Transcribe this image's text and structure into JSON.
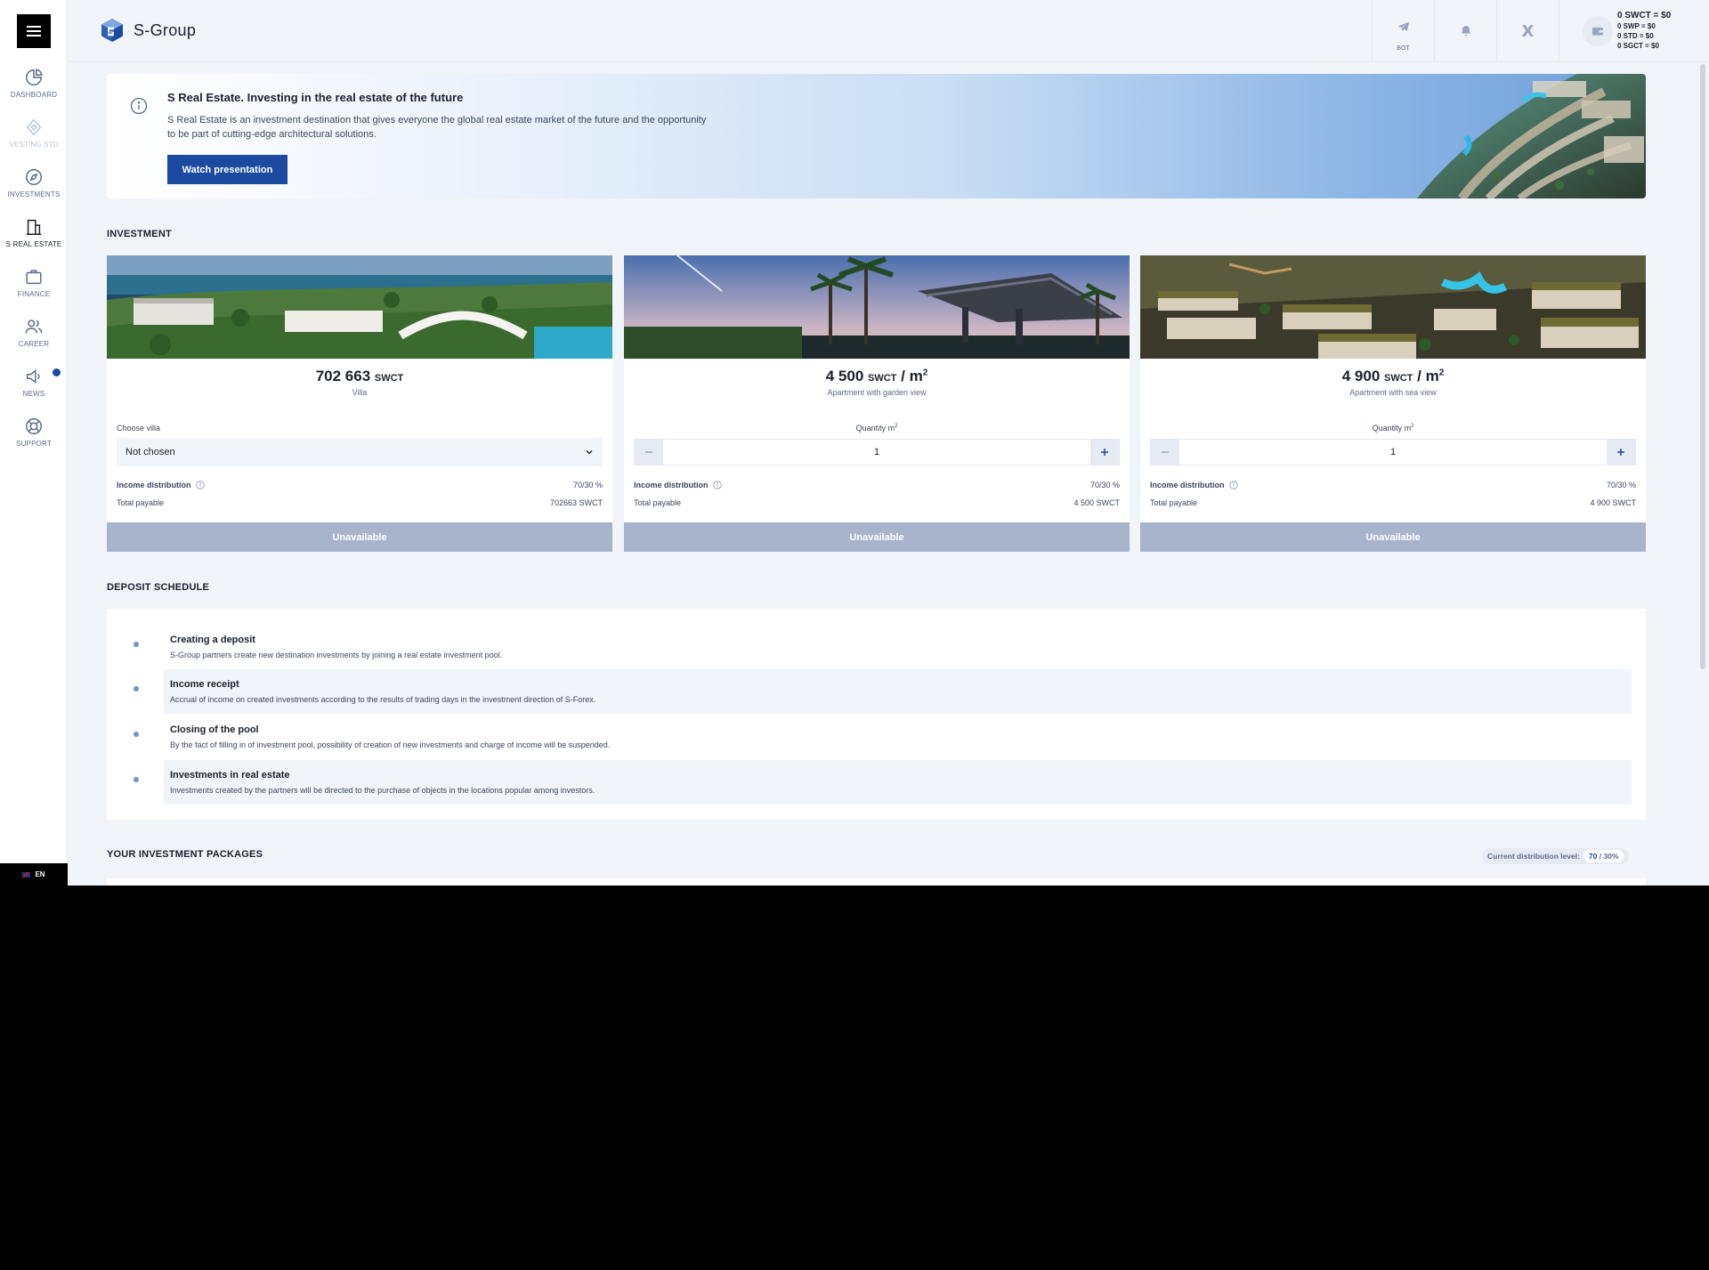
{
  "app": {
    "brand": "S-Group",
    "language": "EN"
  },
  "sidebar": {
    "items": [
      {
        "label": "DASHBOARD",
        "icon": "pie-chart-icon"
      },
      {
        "label": "VESTING STD",
        "icon": "diamond-icon"
      },
      {
        "label": "INVESTMENTS",
        "icon": "compass-icon"
      },
      {
        "label": "S REAL ESTATE",
        "icon": "building-icon"
      },
      {
        "label": "FINANCE",
        "icon": "briefcase-icon"
      },
      {
        "label": "CAREER",
        "icon": "users-icon"
      },
      {
        "label": "NEWS",
        "icon": "megaphone-icon"
      },
      {
        "label": "SUPPORT",
        "icon": "lifebuoy-icon"
      }
    ]
  },
  "topbar": {
    "bot_label": "BOT",
    "x_label": "X",
    "balances": {
      "main": "0 SWCT = $0",
      "swp": "0 SWP = $0",
      "std": "0 STD = $0",
      "sgct": "0 SGCT = $0"
    }
  },
  "banner": {
    "title": "S Real Estate. Investing in the real estate of the future",
    "text": "S Real Estate is an investment destination that gives everyone the global real estate market of the future and the opportunity to be part of cutting-edge architectural solutions.",
    "button": "Watch presentation"
  },
  "investment": {
    "section_title": "INVESTMENT",
    "cards": [
      {
        "price": "702 663",
        "unit": "SWCT",
        "per": "",
        "type": "Villa",
        "field_label": "Choose villa",
        "select_value": "Not chosen",
        "income_label": "Income distribution",
        "income_value": "70/30 %",
        "total_label": "Total payable",
        "total_value": "702663 SWCT",
        "button": "Unavailable"
      },
      {
        "price": "4 500",
        "unit": "SWCT",
        "per": "/ m",
        "sup": "2",
        "type": "Apartment with garden view",
        "field_label": "Quantity m",
        "field_sup": "2",
        "quantity": "1",
        "income_label": "Income distribution",
        "income_value": "70/30 %",
        "total_label": "Total payable",
        "total_value": "4 500 SWCT",
        "button": "Unavailable"
      },
      {
        "price": "4 900",
        "unit": "SWCT",
        "per": "/ m",
        "sup": "2",
        "type": "Apartment with sea view",
        "field_label": "Quantity m",
        "field_sup": "2",
        "quantity": "1",
        "income_label": "Income distribution",
        "income_value": "70/30 %",
        "total_label": "Total payable",
        "total_value": "4 900 SWCT",
        "button": "Unavailable"
      }
    ]
  },
  "deposit_schedule": {
    "section_title": "DEPOSIT SCHEDULE",
    "steps": [
      {
        "title": "Creating a deposit",
        "text": "S-Group partners create new destination investments by joining a real estate investment pool."
      },
      {
        "title": "Income receipt",
        "text": "Accrual of income on created investments according to the results of trading days in the investment direction of S-Forex."
      },
      {
        "title": "Closing of the pool",
        "text": "By the fact of filling in of investment pool, possibility of creation of new investments and charge of income will be suspended."
      },
      {
        "title": "Investments in real estate",
        "text": "Investments created by the partners will be directed to the purchase of objects in the locations popular among investors."
      }
    ]
  },
  "packages": {
    "section_title": "YOUR INVESTMENT PACKAGES",
    "dist_label": "Current distribution level:",
    "dist_primary": "70",
    "dist_rest": " / 30%"
  },
  "colors": {
    "accent": "#1b4aa0",
    "page_bg": "#f1f4f9",
    "disabled_button": "#a8b4cc"
  }
}
